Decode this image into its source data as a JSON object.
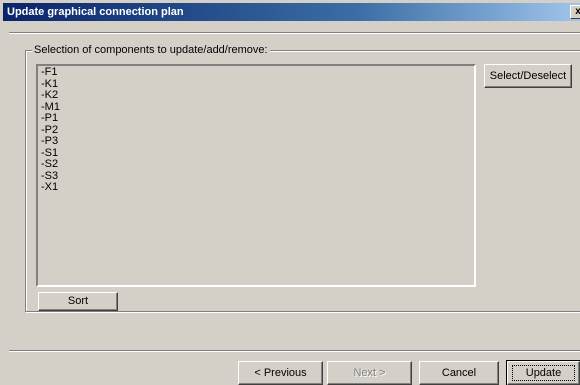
{
  "window": {
    "title": "Update graphical connection plan",
    "close_label": "x"
  },
  "group": {
    "caption": "Selection of components to update/add/remove:"
  },
  "components": {
    "items": [
      "-F1",
      "-K1",
      "-K2",
      "-M1",
      "-P1",
      "-P2",
      "-P3",
      "-S1",
      "-S2",
      "-S3",
      "-X1"
    ]
  },
  "buttons": {
    "select_deselect": "Select/Deselect",
    "sort": "Sort",
    "previous": "< Previous",
    "next": "Next >",
    "cancel": "Cancel",
    "update": "Update"
  },
  "colors": {
    "face": "#d4d0c8",
    "title_start": "#0a246a",
    "title_end": "#a6caf0"
  }
}
